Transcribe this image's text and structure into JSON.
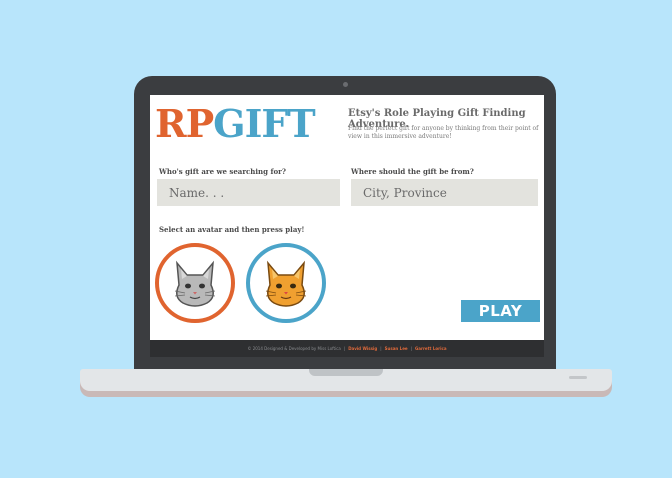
{
  "app": {
    "logo_rp": "RP",
    "logo_gift": "GIFT",
    "tagline": "Etsy's Role Playing Gift Finding Adventure.",
    "description": "Find the perfect gift for anyone by thinking from their point of view in this immersive adventure!"
  },
  "form": {
    "who_label": "Who's gift are we searching for?",
    "name_placeholder": "Name. . .",
    "where_label": "Where should the gift be from?",
    "location_placeholder": "City, Province",
    "avatar_prompt": "Select an avatar and then press play!",
    "play_label": "PLAY"
  },
  "avatars": [
    {
      "icon": "gray-cat-face-icon",
      "ring_color": "#e0642f"
    },
    {
      "icon": "orange-cat-face-icon",
      "ring_color": "#4ba4c9"
    }
  ],
  "footer": {
    "copyright": "© 2014 Designed & Developed by Miss Loftica",
    "credit_1": "David Wissig",
    "credit_2": "Susan Lee",
    "credit_3": "Garrett Lorica"
  },
  "colors": {
    "background": "#b8e5fb",
    "accent_orange": "#e0642f",
    "accent_blue": "#4ba4c9"
  }
}
